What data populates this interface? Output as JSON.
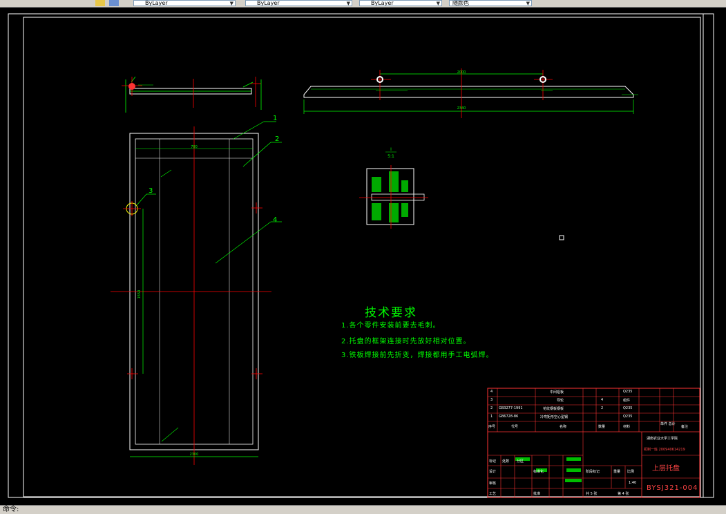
{
  "toolbar": {
    "layer_combo_1": "ByLayer",
    "layer_combo_2": "ByLayer",
    "layer_combo_3": "ByLayer",
    "color_combo": "随颜色"
  },
  "status": {
    "command_prompt": "命令:"
  },
  "drawing": {
    "tech_requirements": {
      "title": "技术要求",
      "items": [
        "1.各个零件安装前要去毛刺。",
        "2.托盘的框架连接时先放好相对位置。",
        "3.铁板焊接前先折变，焊接都用手工电弧焊。"
      ]
    },
    "balloons": [
      "1",
      "2",
      "3",
      "4"
    ],
    "section_label": "I",
    "section_scale": "5:1",
    "dims": {
      "top_width": "2000",
      "top_span": "2340",
      "side_width": "700",
      "front_width": "2300",
      "front_inner": "1550"
    },
    "title_block": {
      "bom_rows": [
        {
          "no": "4",
          "code": "",
          "name": "中间铝板",
          "qty": "",
          "material": "Q235",
          "note": ""
        },
        {
          "no": "3",
          "code": "",
          "name": "导轮",
          "qty": "4",
          "material": "组件",
          "note": ""
        },
        {
          "no": "2",
          "code": "GB3277-1991",
          "name": "花纹钢板钢板",
          "qty": "2",
          "material": "Q235",
          "note": ""
        },
        {
          "no": "1",
          "code": "GB6728-86",
          "name": "冷弯矩形空心型钢",
          "qty": "",
          "material": "Q235",
          "note": ""
        }
      ],
      "header": {
        "no": "序号",
        "code": "代号",
        "name": "名称",
        "qty": "数量",
        "material": "材料",
        "weight": "单件 总计",
        "note": "备注"
      },
      "school": "湖南农业大学工学院",
      "class_info": "机制一班 200940614219",
      "drawing_name": "上层托盘",
      "drawing_no": "BYSJ321-004",
      "scale": "1:40",
      "sheet": "共 5 张",
      "sheet_no": "第 4 张",
      "labels": {
        "design": "设计",
        "standard": "标准化",
        "review": "审核",
        "process": "工艺",
        "approve": "批准",
        "stage": "阶段标记",
        "weight": "重量",
        "ratio": "比例",
        "mark": "标记",
        "count": "处数",
        "zone": "分区"
      }
    }
  },
  "colors": {
    "line_green": "#00ff00",
    "line_red": "#ff0000",
    "line_white": "#ffffff",
    "frame": "#ffffff",
    "title_border": "#ff3333"
  }
}
